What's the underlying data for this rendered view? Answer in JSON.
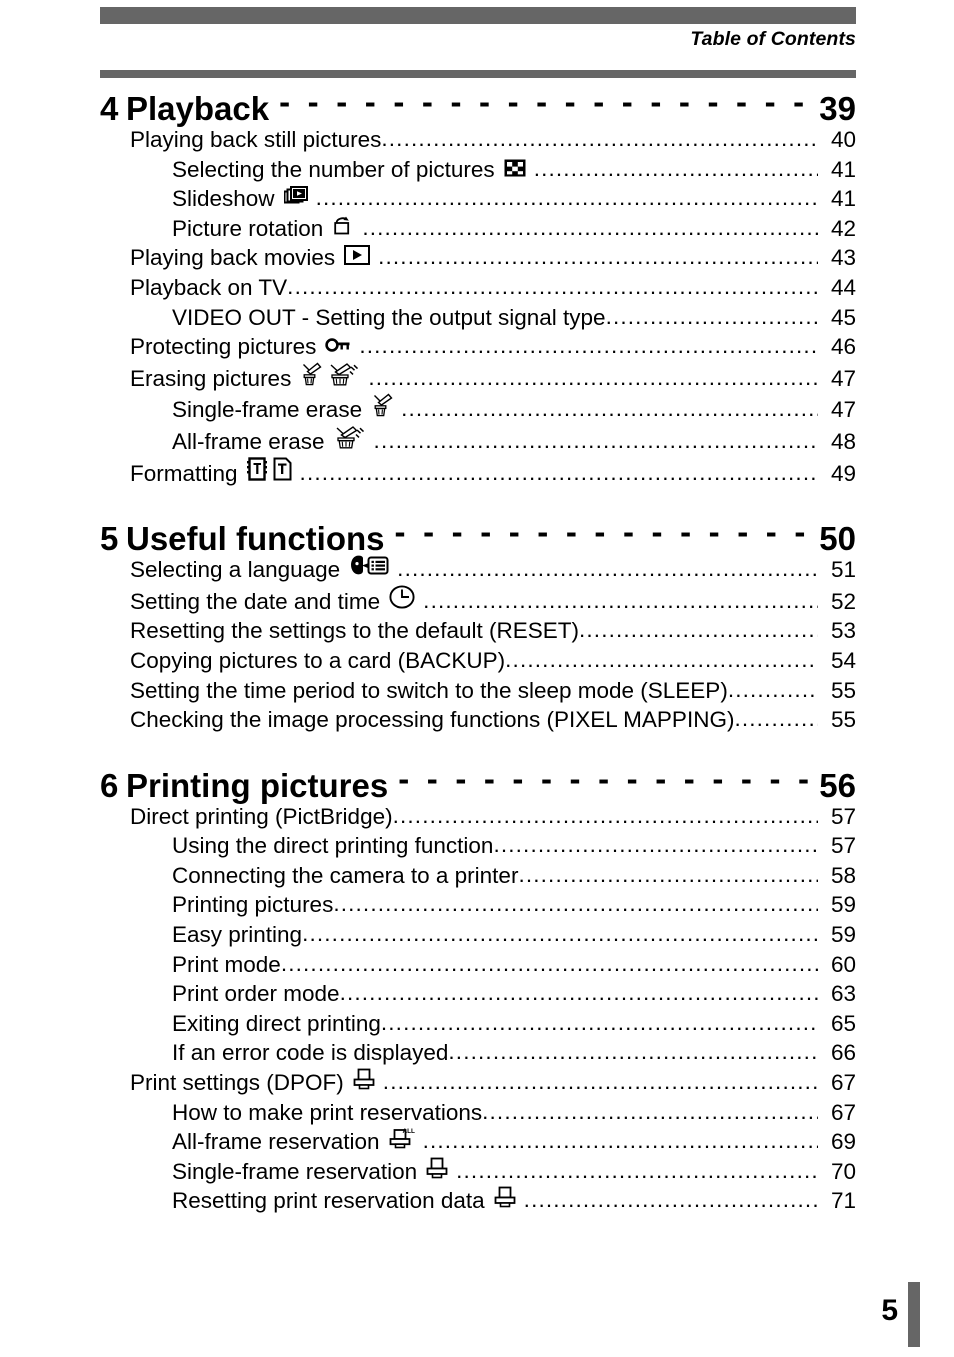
{
  "header": {
    "label": "Table of Contents",
    "bar_color": "#666666"
  },
  "footer": {
    "page_number": "5",
    "bar_color": "#666666"
  },
  "dot_leader": "........................................................................................................................",
  "dash_leader": "- - - - - - - - - - - - - - - - - - - - - - - - - - - - - - - - - - - - -",
  "chapters": [
    {
      "number": "4",
      "title": "Playback",
      "page": "39",
      "entries": [
        {
          "level": 1,
          "label": "Playing back still pictures",
          "icons": [],
          "page": "40"
        },
        {
          "level": 2,
          "label": "Selecting the number of pictures",
          "icons": [
            "index-thumbnail-icon"
          ],
          "page": "41"
        },
        {
          "level": 2,
          "label": "Slideshow",
          "icons": [
            "slideshow-icon"
          ],
          "page": "41"
        },
        {
          "level": 2,
          "label": "Picture rotation",
          "icons": [
            "picture-rotation-icon"
          ],
          "page": "42"
        },
        {
          "level": 1,
          "label": "Playing back movies",
          "icons": [
            "movie-play-icon"
          ],
          "page": "43"
        },
        {
          "level": 1,
          "label": "Playback on TV",
          "icons": [],
          "page": "44"
        },
        {
          "level": 2,
          "label": "VIDEO OUT - Setting the output signal type",
          "icons": [],
          "page": "45"
        },
        {
          "level": 1,
          "label": "Protecting pictures",
          "icons": [
            "key-protect-icon"
          ],
          "page": "46"
        },
        {
          "level": 1,
          "label": "Erasing pictures",
          "icons": [
            "single-erase-icon",
            "all-erase-icon"
          ],
          "page": "47"
        },
        {
          "level": 2,
          "label": "Single-frame erase",
          "icons": [
            "single-erase-icon"
          ],
          "page": "47"
        },
        {
          "level": 2,
          "label": "All-frame erase",
          "icons": [
            "all-erase-icon"
          ],
          "page": "48"
        },
        {
          "level": 1,
          "label": "Formatting",
          "icons": [
            "format-card-icon",
            "format-memory-icon"
          ],
          "page": "49"
        }
      ]
    },
    {
      "number": "5",
      "title": "Useful functions",
      "page": "50",
      "entries": [
        {
          "level": 1,
          "label": "Selecting a language",
          "icons": [
            "language-icon"
          ],
          "page": "51"
        },
        {
          "level": 1,
          "label": "Setting the date and time",
          "icons": [
            "clock-icon"
          ],
          "page": "52"
        },
        {
          "level": 1,
          "label": "Resetting the settings to the default (RESET)",
          "icons": [],
          "page": "53"
        },
        {
          "level": 1,
          "label": "Copying pictures to a card (BACKUP)",
          "icons": [],
          "page": "54"
        },
        {
          "level": 1,
          "label": "Setting the time period to switch to the sleep mode (SLEEP)",
          "icons": [],
          "page": "55"
        },
        {
          "level": 1,
          "label": "Checking the image processing functions (PIXEL MAPPING)",
          "icons": [],
          "page": "55"
        }
      ]
    },
    {
      "number": "6",
      "title": "Printing pictures",
      "page": "56",
      "entries": [
        {
          "level": 1,
          "label": "Direct printing (PictBridge)",
          "icons": [],
          "page": "57"
        },
        {
          "level": 2,
          "label": "Using the direct printing function",
          "icons": [],
          "page": "57"
        },
        {
          "level": 2,
          "label": "Connecting the camera to a printer",
          "icons": [],
          "page": "58"
        },
        {
          "level": 2,
          "label": "Printing pictures",
          "icons": [],
          "page": "59"
        },
        {
          "level": 2,
          "label": "Easy printing",
          "icons": [],
          "page": "59"
        },
        {
          "level": 2,
          "label": "Print mode",
          "icons": [],
          "page": "60"
        },
        {
          "level": 2,
          "label": "Print order mode",
          "icons": [],
          "page": "63"
        },
        {
          "level": 2,
          "label": "Exiting direct printing",
          "icons": [],
          "page": "65"
        },
        {
          "level": 2,
          "label": "If an error code is displayed",
          "icons": [],
          "page": "66"
        },
        {
          "level": 1,
          "label": "Print settings (DPOF)",
          "icons": [
            "print-reserve-icon"
          ],
          "page": "67"
        },
        {
          "level": 2,
          "label": "How to make print reservations",
          "icons": [],
          "page": "67"
        },
        {
          "level": 2,
          "label": "All-frame reservation",
          "icons": [
            "print-reserve-all-icon"
          ],
          "page": "69"
        },
        {
          "level": 2,
          "label": "Single-frame reservation",
          "icons": [
            "print-reserve-icon"
          ],
          "page": "70"
        },
        {
          "level": 2,
          "label": "Resetting print reservation data",
          "icons": [
            "print-reserve-icon"
          ],
          "page": "71"
        }
      ]
    }
  ]
}
